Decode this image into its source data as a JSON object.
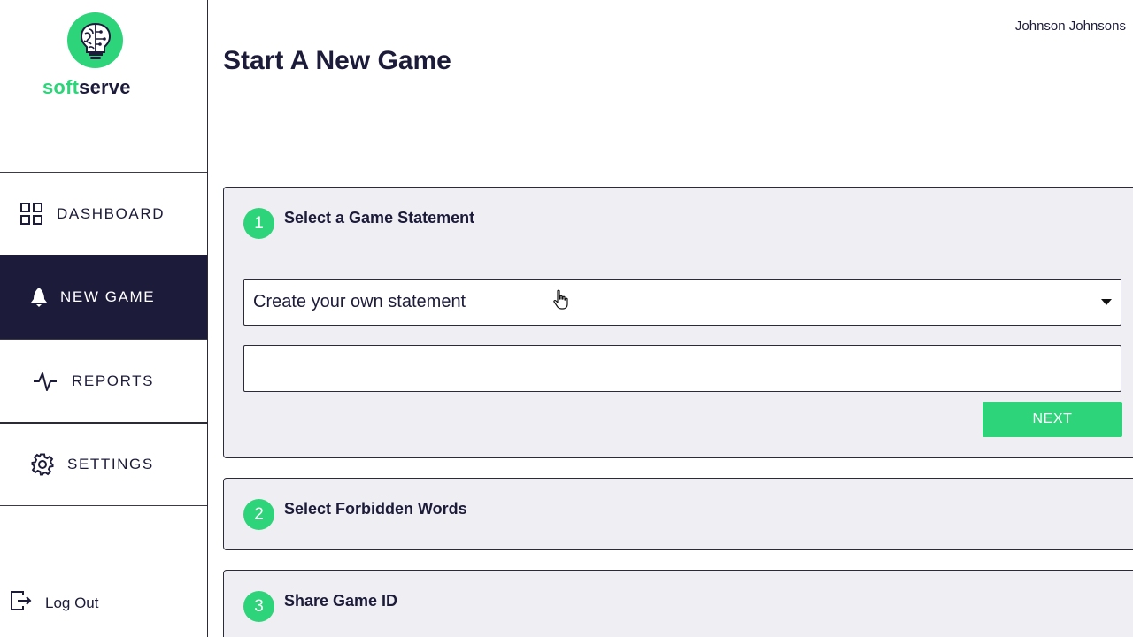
{
  "brand": {
    "part1": "soft",
    "part2": "serve",
    "logo_icon": "brain-bulb-icon",
    "accent_color": "#2ed47a",
    "dark_color": "#1c1b3a"
  },
  "sidebar": {
    "items": [
      {
        "label": "DASHBOARD",
        "icon": "grid-icon",
        "active": false
      },
      {
        "label": "NEW GAME",
        "icon": "rocket-icon",
        "active": true
      },
      {
        "label": "REPORTS",
        "icon": "pulse-icon",
        "active": false
      },
      {
        "label": "SETTINGS",
        "icon": "gear-icon",
        "active": false
      }
    ],
    "logout": {
      "label": "Log Out",
      "icon": "logout-icon"
    }
  },
  "header": {
    "user_name": "Johnson Johnsons"
  },
  "main": {
    "title": "Start A New Game",
    "steps": [
      {
        "number": "1",
        "title": "Select a Game Statement",
        "select_value": "Create your own statement",
        "input_value": "",
        "next_label": "NEXT"
      },
      {
        "number": "2",
        "title": "Select Forbidden Words"
      },
      {
        "number": "3",
        "title": "Share Game ID"
      }
    ]
  }
}
